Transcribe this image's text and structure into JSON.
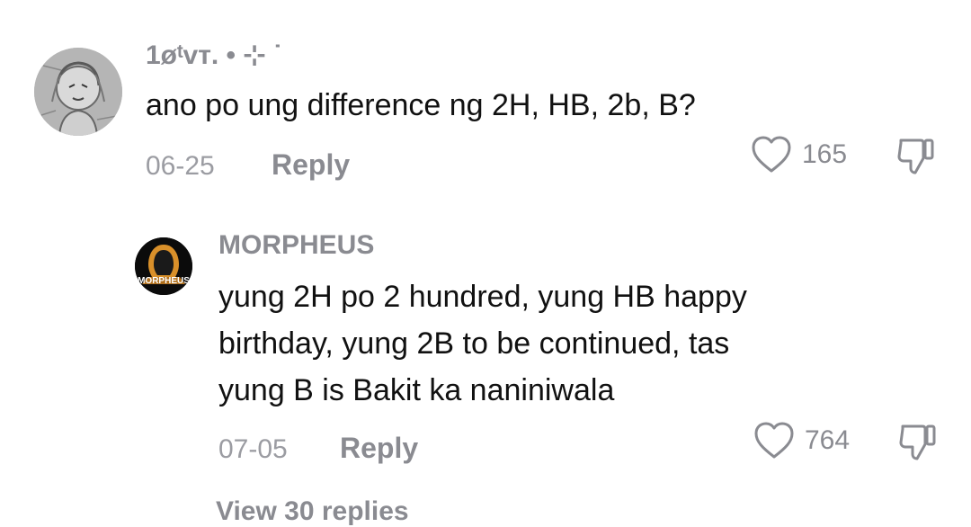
{
  "comments": [
    {
      "username": "1øᵗvᴛ. • ⊹ ˙",
      "text": "ano po ung difference ng 2H, HB, 2b, B?",
      "date": "06-25",
      "reply_label": "Reply",
      "likes": "165"
    },
    {
      "username": "MORPHEUS",
      "avatar_text": "MORPHEUS",
      "text_lines": [
        "yung 2H po 2 hundred, yung HB happy",
        "birthday, yung 2B to be continued, tas",
        "yung B is Bakit ka naniniwala"
      ],
      "date": "07-05",
      "reply_label": "Reply",
      "likes": "764"
    }
  ],
  "view_more": "View 30 replies",
  "icons": {
    "like": "heart-outline-icon",
    "dislike": "thumbs-down-outline-icon"
  }
}
